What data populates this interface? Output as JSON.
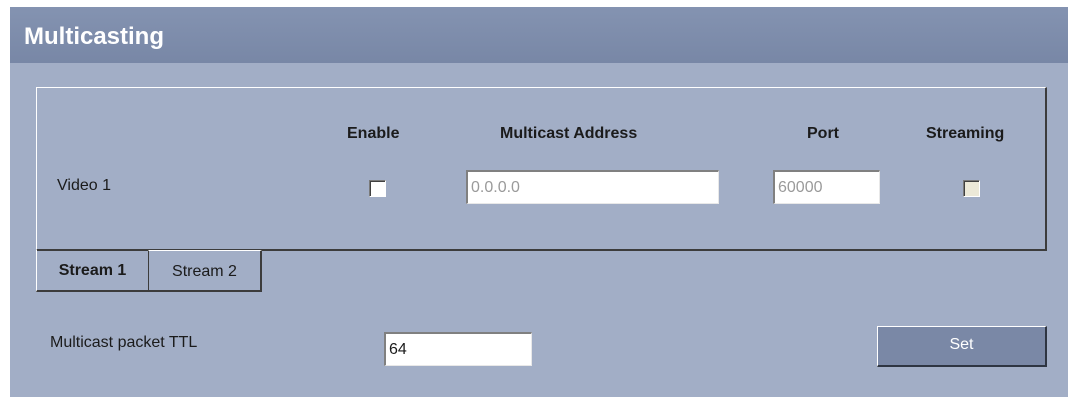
{
  "header": {
    "title": "Multicasting"
  },
  "table": {
    "columns": {
      "enable": "Enable",
      "multicast_address": "Multicast Address",
      "port": "Port",
      "streaming": "Streaming"
    },
    "rows": [
      {
        "label": "Video 1",
        "enable_checked": false,
        "multicast_address": "0.0.0.0",
        "port": "60000",
        "streaming_checked": false
      }
    ]
  },
  "tabs": [
    {
      "label": "Stream 1",
      "active": true
    },
    {
      "label": "Stream 2",
      "active": false
    }
  ],
  "ttl": {
    "label": "Multicast packet TTL",
    "value": "64"
  },
  "actions": {
    "set_label": "Set"
  },
  "colors": {
    "panel_background": "#a2aec6",
    "title_bar": "#7887a6",
    "button": "#7a88a6"
  }
}
